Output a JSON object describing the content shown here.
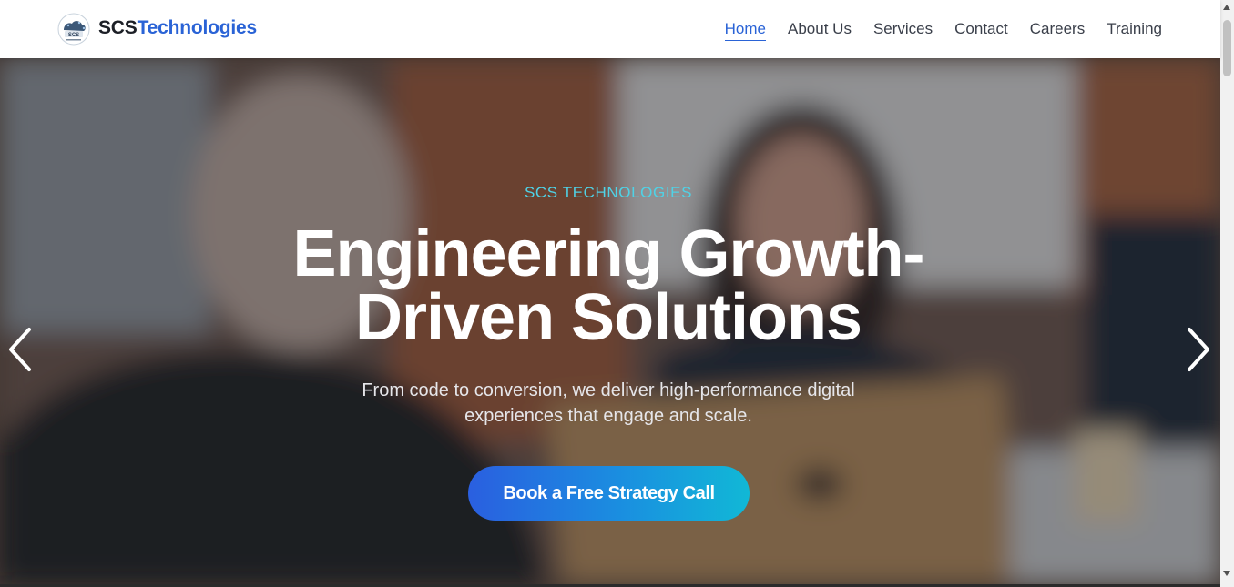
{
  "header": {
    "brand_prefix": "SCS",
    "brand_suffix": "Technologies",
    "logo_icon": "scs-logo-icon",
    "nav": [
      {
        "label": "Home",
        "active": true
      },
      {
        "label": "About Us",
        "active": false
      },
      {
        "label": "Services",
        "active": false
      },
      {
        "label": "Contact",
        "active": false
      },
      {
        "label": "Careers",
        "active": false
      },
      {
        "label": "Training",
        "active": false
      }
    ]
  },
  "hero": {
    "eyebrow": "SCS TECHNOLOGIES",
    "headline": "Engineering Growth-Driven Solutions",
    "subtext": "From code to conversion, we deliver high-performance digital experiences that engage and scale.",
    "cta_label": "Book a Free Strategy Call",
    "prev_icon": "chevron-left-icon",
    "next_icon": "chevron-right-icon"
  },
  "colors": {
    "brand_blue": "#2a63d6",
    "eyebrow_cyan": "#4fd2e6",
    "cta_gradient_start": "#2a5fe0",
    "cta_gradient_end": "#11b8d6"
  }
}
